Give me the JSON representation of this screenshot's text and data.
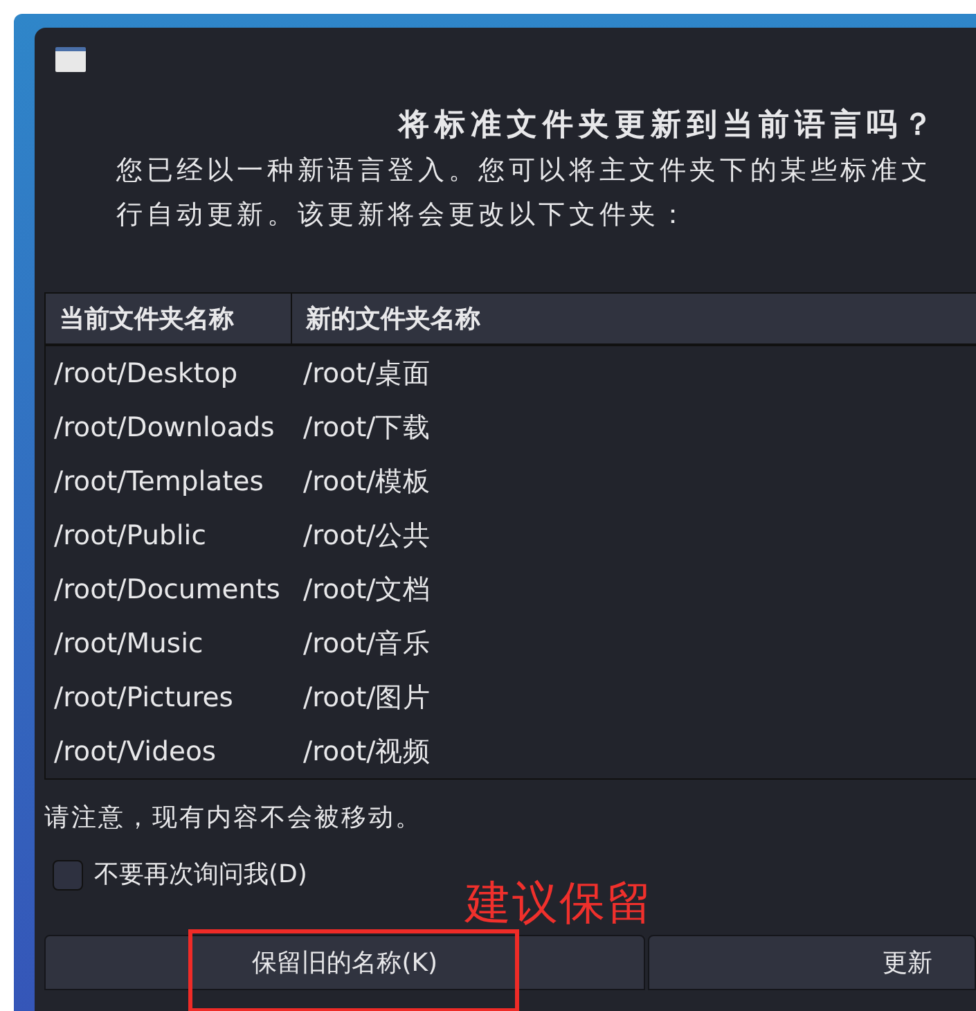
{
  "dialog": {
    "title": "将标准文件夹更新到当前语言吗？",
    "message_lines": [
      "您已经以一种新语言登入。您可以将主文件夹下的某些标准文",
      "行自动更新。该更新将会更改以下文件夹："
    ],
    "table": {
      "columns": [
        "当前文件夹名称",
        "新的文件夹名称"
      ],
      "rows": [
        [
          "/root/Desktop",
          "/root/桌面"
        ],
        [
          "/root/Downloads",
          "/root/下载"
        ],
        [
          "/root/Templates",
          "/root/模板"
        ],
        [
          "/root/Public",
          "/root/公共"
        ],
        [
          "/root/Documents",
          "/root/文档"
        ],
        [
          "/root/Music",
          "/root/音乐"
        ],
        [
          "/root/Pictures",
          "/root/图片"
        ],
        [
          "/root/Videos",
          "/root/视频"
        ]
      ]
    },
    "note": "请注意，现有内容不会被移动。",
    "dont_ask_again": {
      "label": "不要再次询问我(D)",
      "checked": false
    },
    "buttons": [
      {
        "label": "保留旧的名称(K)",
        "highlighted": true
      },
      {
        "label": "更新",
        "highlighted": false
      }
    ]
  },
  "annotation": {
    "text": "建议保留"
  }
}
